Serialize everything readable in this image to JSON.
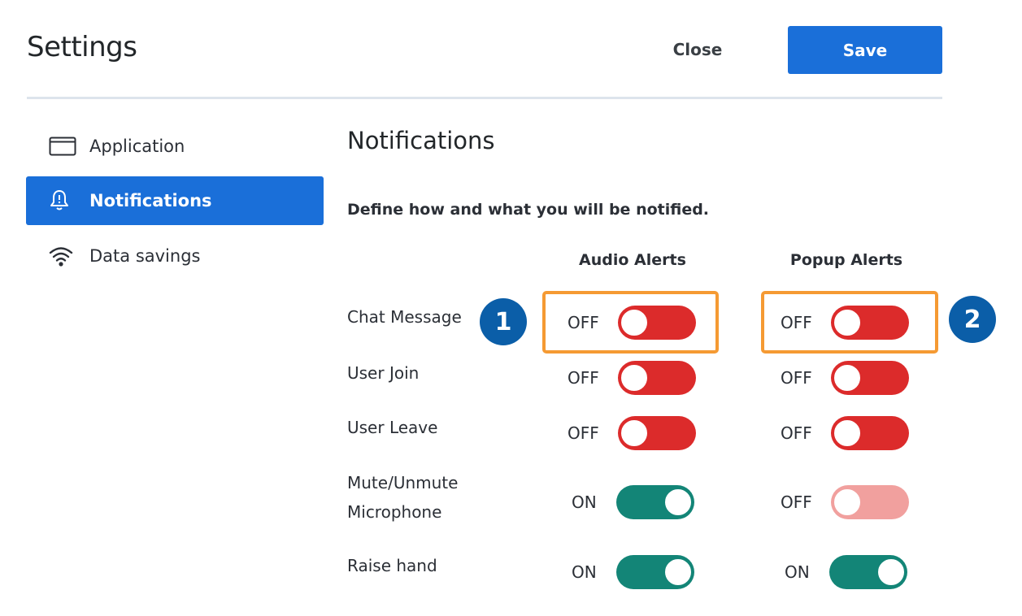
{
  "header": {
    "title": "Settings",
    "close_label": "Close",
    "save_label": "Save"
  },
  "sidebar": {
    "items": [
      {
        "label": "Application",
        "icon": "application-window-icon",
        "active": false
      },
      {
        "label": "Notifications",
        "icon": "bell-icon",
        "active": true
      },
      {
        "label": "Data savings",
        "icon": "wifi-icon",
        "active": false
      }
    ]
  },
  "main": {
    "title": "Notifications",
    "description": "Define how and what you will be notified.",
    "columns": [
      "Audio Alerts",
      "Popup Alerts"
    ],
    "rows": [
      {
        "label": "Chat Message",
        "audio": "OFF",
        "popup": "OFF"
      },
      {
        "label": "User Join",
        "audio": "OFF",
        "popup": "OFF"
      },
      {
        "label": "User Leave",
        "audio": "OFF",
        "popup": "OFF"
      },
      {
        "label": "Mute/Unmute Microphone",
        "label_lines": [
          "Mute/Unmute",
          "Microphone"
        ],
        "audio": "ON",
        "popup": "OFF",
        "popup_disabled": true
      },
      {
        "label": "Raise hand",
        "audio": "ON",
        "popup": "ON"
      }
    ]
  },
  "annotations": {
    "badge_1": "1",
    "badge_2": "2",
    "highlight_color": "#f59a33",
    "badge_color": "#0b5ea8"
  },
  "colors": {
    "accent": "#1a6fd9",
    "toggle_off": "#dc2b2b",
    "toggle_off_disabled": "#f1a09e",
    "toggle_on": "#138577"
  }
}
